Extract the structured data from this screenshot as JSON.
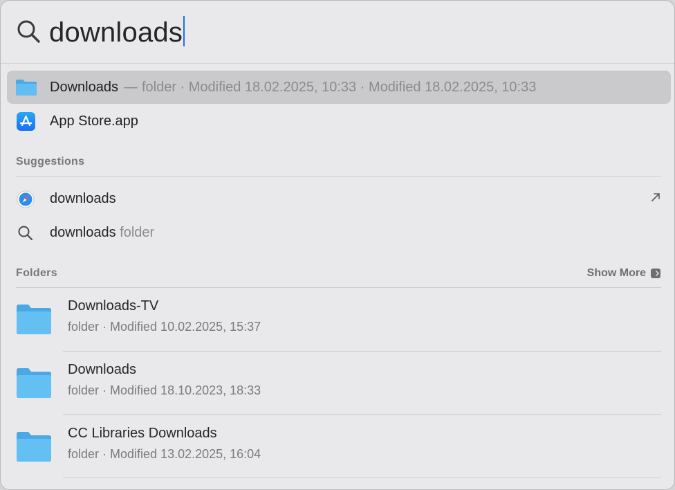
{
  "search": {
    "query": "downloads"
  },
  "top_results": [
    {
      "name": "Downloads",
      "meta": "folder · Modified 18.02.2025, 10:33  ·  Modified 18.02.2025, 10:33",
      "icon": "folder-icon",
      "selected": true
    },
    {
      "name": "App Store.app",
      "icon": "app-store-icon",
      "selected": false
    }
  ],
  "suggestions": {
    "title": "Suggestions",
    "items": [
      {
        "term": "downloads",
        "suffix": "",
        "icon": "safari-icon"
      },
      {
        "term": "downloads",
        "suffix": " folder",
        "icon": "search-icon"
      }
    ]
  },
  "folders": {
    "title": "Folders",
    "show_more": "Show More",
    "items": [
      {
        "name": "Downloads-TV",
        "sub": "folder · Modified 10.02.2025, 15:37"
      },
      {
        "name": "Downloads",
        "sub": "folder · Modified 18.10.2023, 18:33"
      },
      {
        "name": "CC Libraries Downloads",
        "sub": "folder · Modified 13.02.2025, 16:04"
      }
    ]
  },
  "colors": {
    "accent_caret": "#1f6fe5",
    "folder_blue": "#5bb8ef",
    "selection": "#cacacc"
  }
}
